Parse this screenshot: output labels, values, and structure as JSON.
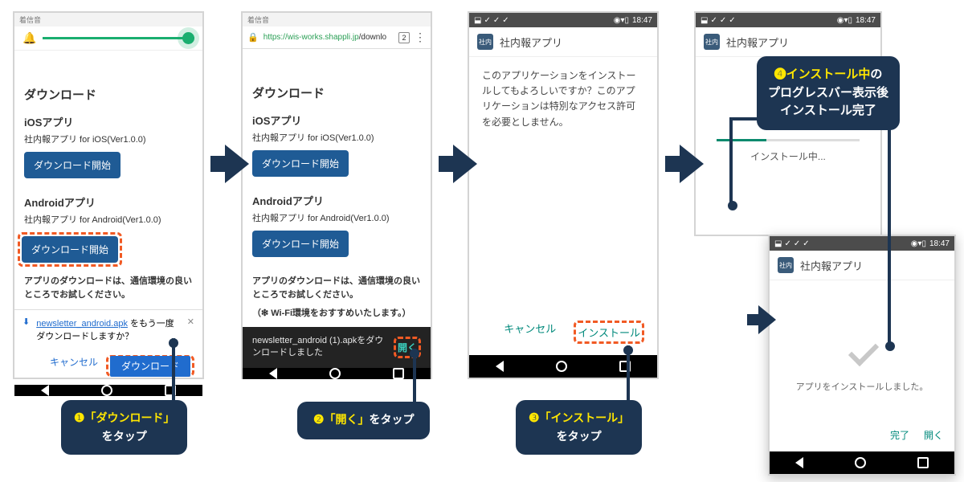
{
  "notif_label": "着信音",
  "statusbar_time": "18:47",
  "app_title": "社内報アプリ",
  "url_tabs": "2",
  "url_host": "https://wis-works.shappli.jp",
  "url_path": "/downlo",
  "page_h1": "ダウンロード",
  "ios_h2": "iOSアプリ",
  "ios_line": "社内報アプリ for iOS(Ver1.0.0)",
  "android_h2": "Androidアプリ",
  "android_line": "社内報アプリ for Android(Ver1.0.0)",
  "btn_dl": "ダウンロード開始",
  "note1": "アプリのダウンロードは、通信環境の良いところでお試しください。",
  "note2": "（❇ Wi-Fi環境をおすすめいたします。）",
  "redl_file": "newsletter_android.apk",
  "redl_text": " をもう一度ダウンロードしますか？",
  "redl_cancel": "キャンセル",
  "redl_main": "ダウンロード",
  "snackbar_text": "newsletter_android (1).apkをダウンロードしました",
  "snackbar_open": "開く",
  "install_q": "このアプリケーションをインストールしてもよろしいですか？このアプリケーションは特別なアクセス許可を必要としません。",
  "install_cancel": "キャンセル",
  "install_do": "インストール",
  "installing": "インストール中...",
  "installed": "アプリをインストールしました。",
  "done_btn": "完了",
  "open_btn": "開く",
  "c1_num": "❶",
  "c1_a": "「ダウンロード」",
  "c1_b": "をタップ",
  "c2_num": "❷",
  "c2_a": "「開く」",
  "c2_b": "をタップ",
  "c3_num": "❸",
  "c3_a": "「インストール」",
  "c3_b": "をタップ",
  "c4_num": "❹",
  "c4_a": "インストール中",
  "c4_b": "の",
  "c4_c": "プログレスバー表示後",
  "c4_d": "インストール完了"
}
